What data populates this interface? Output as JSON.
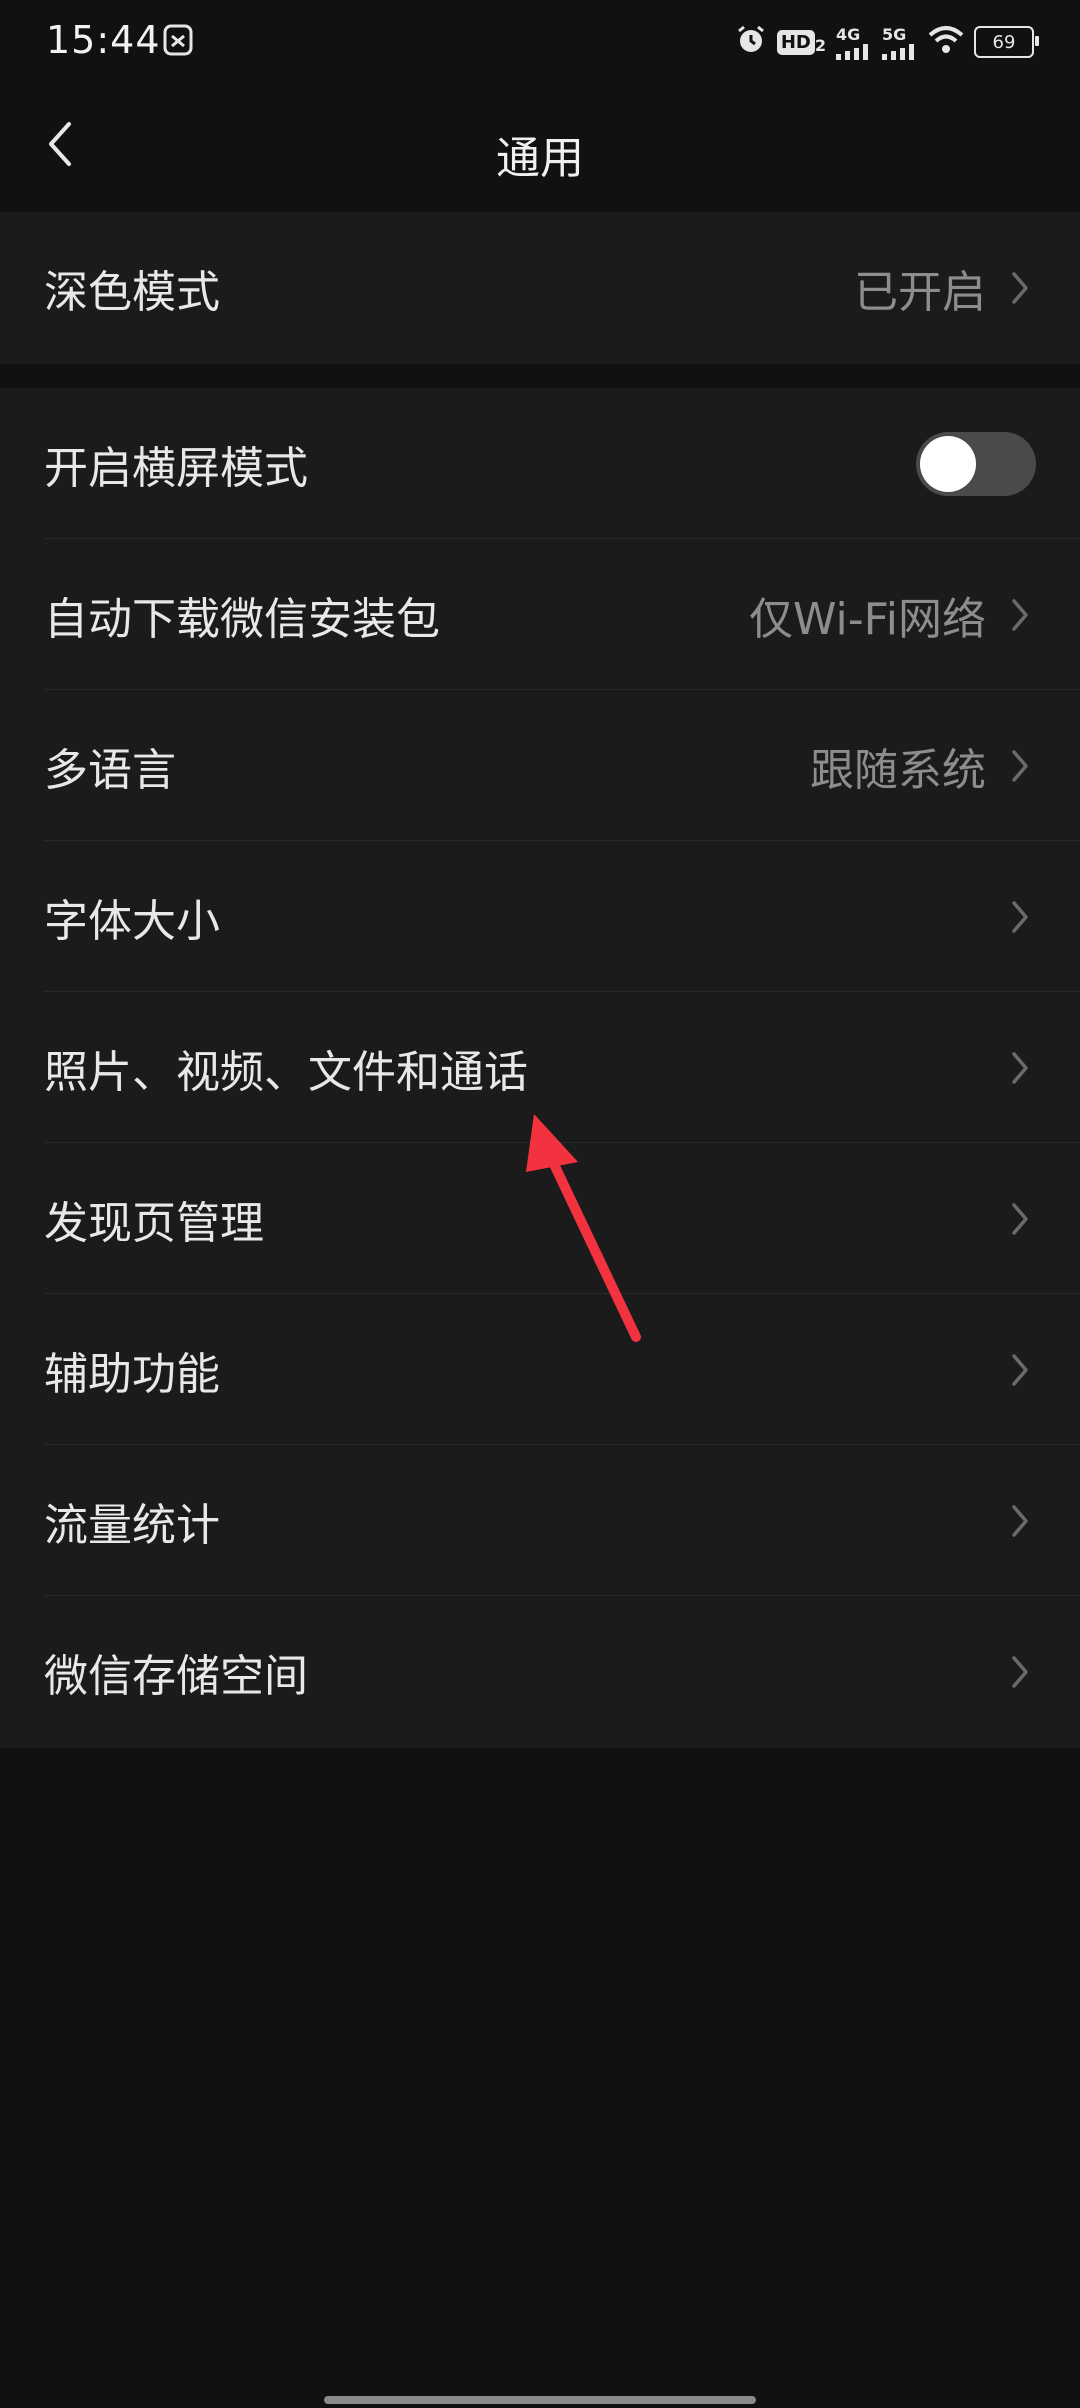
{
  "status_bar": {
    "time": "15:44",
    "hd": "HD",
    "hd_sub": "2",
    "net1": "4G",
    "net2": "5G",
    "battery": "69"
  },
  "nav": {
    "title": "通用"
  },
  "group1": {
    "dark_mode": {
      "label": "深色模式",
      "value": "已开启"
    }
  },
  "group2": {
    "landscape": {
      "label": "开启横屏模式",
      "toggle_on": false
    },
    "auto_download": {
      "label": "自动下载微信安装包",
      "value": "仅Wi-Fi网络"
    },
    "language": {
      "label": "多语言",
      "value": "跟随系统"
    },
    "font_size": {
      "label": "字体大小"
    },
    "media": {
      "label": "照片、视频、文件和通话"
    },
    "discover": {
      "label": "发现页管理"
    },
    "accessibility": {
      "label": "辅助功能"
    },
    "traffic": {
      "label": "流量统计"
    },
    "storage": {
      "label": "微信存储空间"
    }
  },
  "colors": {
    "background": "#111111",
    "cell": "#1b1b1b",
    "annotation_arrow": "#f2333f"
  }
}
